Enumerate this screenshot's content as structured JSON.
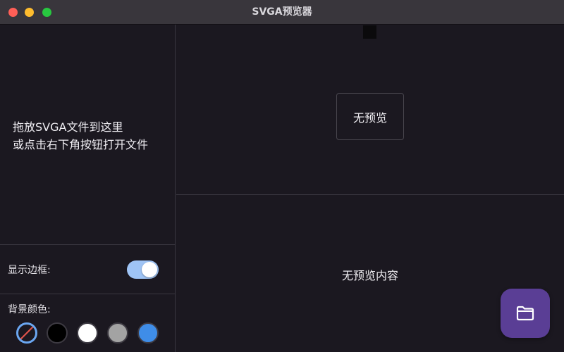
{
  "window": {
    "title": "SVGA预览器"
  },
  "sidebar": {
    "drop_hint_line1": "拖放SVGA文件到这里",
    "drop_hint_line2": "或点击右下角按钮打开文件",
    "show_border_label": "显示边框:",
    "show_border_enabled": true,
    "background_color_label": "背景颜色:",
    "background_options": [
      {
        "name": "transparent",
        "color": "#1b1820",
        "selected": true
      },
      {
        "name": "black",
        "color": "#000000",
        "selected": false
      },
      {
        "name": "white",
        "color": "#ffffff",
        "selected": false
      },
      {
        "name": "gray",
        "color": "#a3a3a3",
        "selected": false
      },
      {
        "name": "blue",
        "color": "#3f8de8",
        "selected": false
      }
    ]
  },
  "preview": {
    "placeholder_label": "无预览",
    "empty_content_label": "无预览内容"
  },
  "actions": {
    "open_file_icon": "folder-icon",
    "accent_color": "#5a3e95"
  }
}
